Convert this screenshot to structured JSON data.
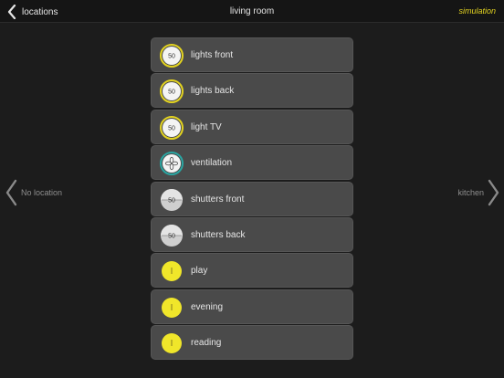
{
  "header": {
    "back_label": "locations",
    "title": "living room",
    "mode": "simulation"
  },
  "nav": {
    "prev": "No location",
    "next": "kitchen"
  },
  "items": [
    {
      "label": "lights front",
      "type": "dimmer",
      "value": "50"
    },
    {
      "label": "lights back",
      "type": "dimmer",
      "value": "50"
    },
    {
      "label": "light TV",
      "type": "dimmer",
      "value": "50"
    },
    {
      "label": "ventilation",
      "type": "fan"
    },
    {
      "label": "shutters front",
      "type": "shutter",
      "value": "50"
    },
    {
      "label": "shutters back",
      "type": "shutter",
      "value": "50"
    },
    {
      "label": "play",
      "type": "scene"
    },
    {
      "label": "evening",
      "type": "scene"
    },
    {
      "label": "reading",
      "type": "scene"
    }
  ],
  "colors": {
    "accent": "#e3d320",
    "fan_ring": "#2aa6a2",
    "row_bg": "#4a4a4a",
    "bg": "#1c1c1c"
  }
}
